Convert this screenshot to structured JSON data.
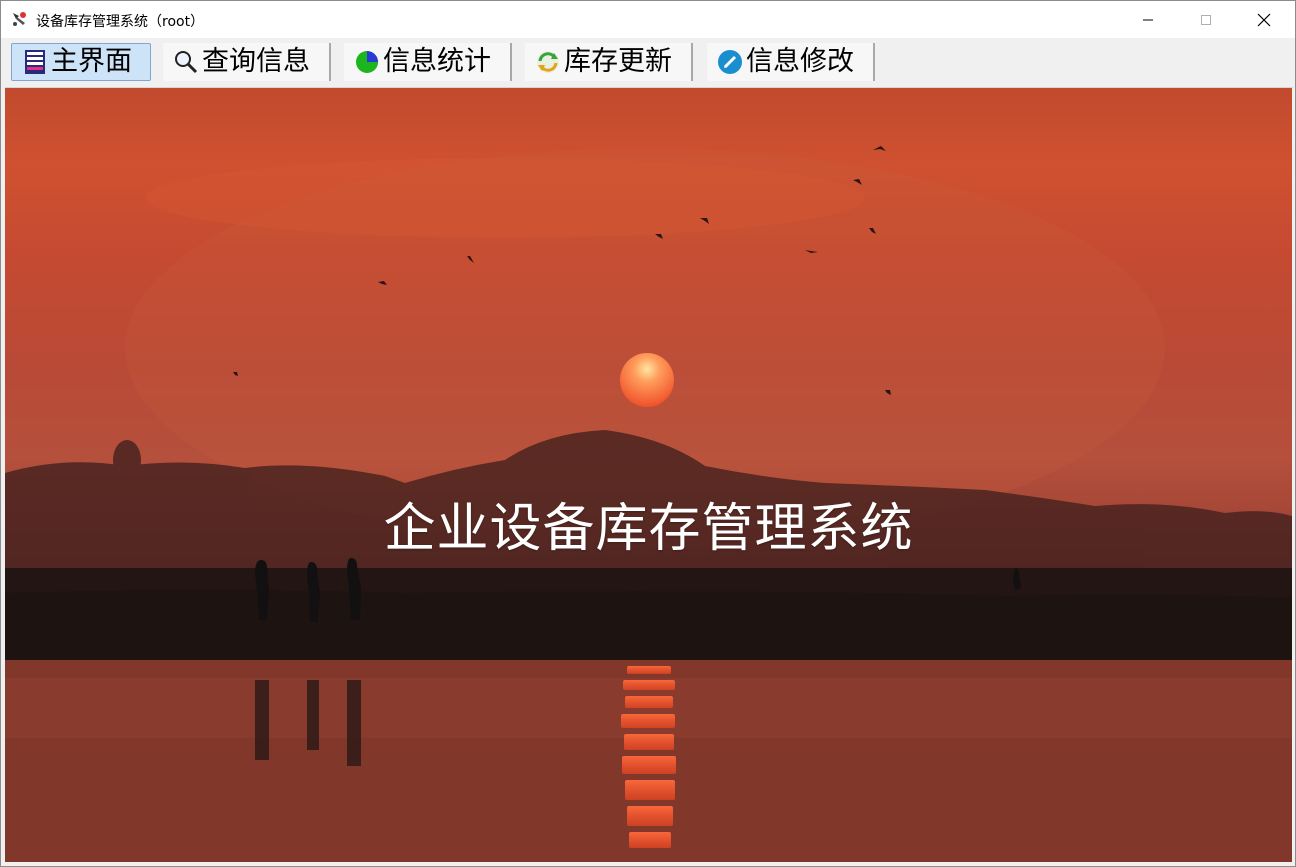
{
  "window": {
    "title": "设备库存管理系统（root）",
    "icon": "app-icon"
  },
  "toolbar": {
    "tabs": [
      {
        "label": "主界面",
        "icon": "home-screen-icon",
        "active": true
      },
      {
        "label": "查询信息",
        "icon": "magnifier-icon",
        "active": false
      },
      {
        "label": "信息统计",
        "icon": "pie-chart-icon",
        "active": false
      },
      {
        "label": "库存更新",
        "icon": "refresh-icon",
        "active": false
      },
      {
        "label": "信息修改",
        "icon": "edit-pencil-icon",
        "active": false
      }
    ]
  },
  "main": {
    "heading": "企业设备库存管理系统",
    "background": "sunset-lake-photo"
  },
  "colors": {
    "sky": "#cf5131",
    "sun": "#ff5a2e",
    "tab_active_bg": "#cde3f7",
    "tab_active_border": "#7fa6cd"
  }
}
